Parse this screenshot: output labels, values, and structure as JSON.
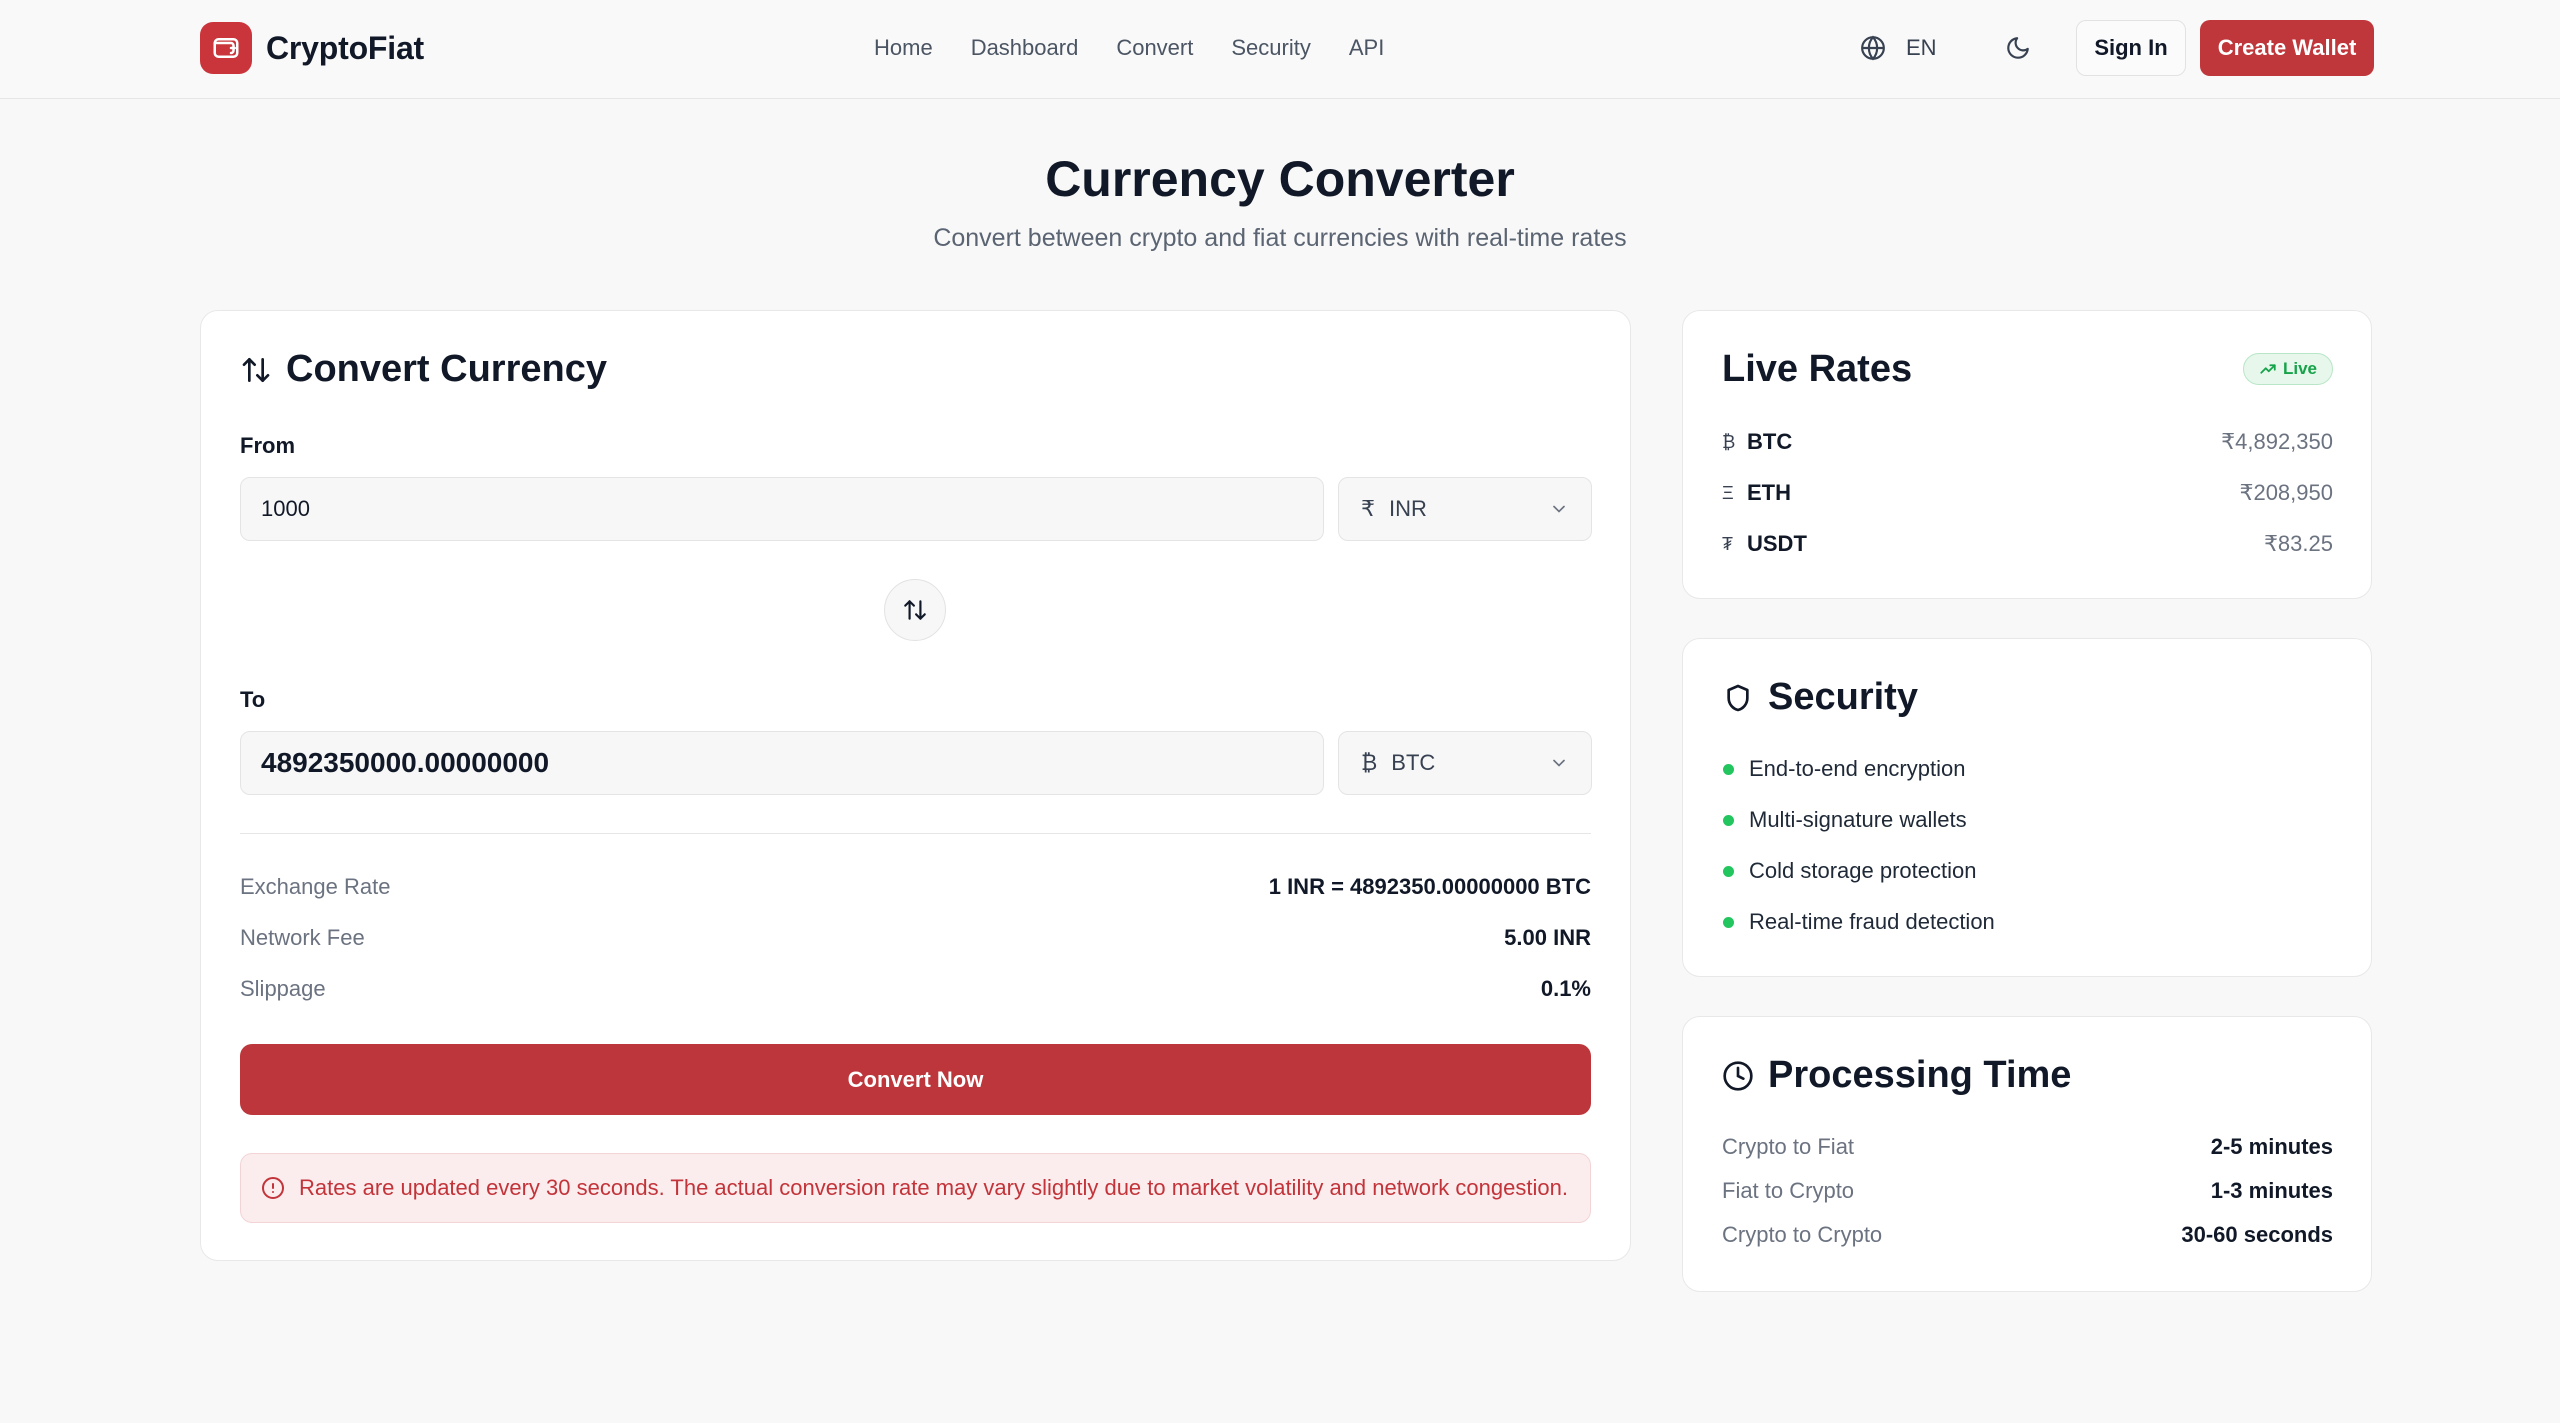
{
  "header": {
    "brand": "CryptoFiat",
    "nav": [
      "Home",
      "Dashboard",
      "Convert",
      "Security",
      "API"
    ],
    "language": "EN",
    "sign_in": "Sign In",
    "create_wallet": "Create Wallet"
  },
  "hero": {
    "title": "Currency Converter",
    "subtitle": "Convert between crypto and fiat currencies with real-time rates"
  },
  "converter": {
    "title": "Convert Currency",
    "from_label": "From",
    "from_amount": "1000",
    "from_currency_symbol": "₹",
    "from_currency": "INR",
    "to_label": "To",
    "to_amount": "4892350000.00000000",
    "to_currency_symbol": "₿",
    "to_currency": "BTC",
    "details": [
      {
        "key": "Exchange Rate",
        "value": "1 INR = 4892350.00000000 BTC"
      },
      {
        "key": "Network Fee",
        "value": "5.00 INR"
      },
      {
        "key": "Slippage",
        "value": "0.1%"
      }
    ],
    "convert_button": "Convert Now",
    "notice": "Rates are updated every 30 seconds. The actual conversion rate may vary slightly due to market volatility and network congestion."
  },
  "live_rates": {
    "title": "Live Rates",
    "badge": "Live",
    "rates": [
      {
        "symbol": "₿",
        "name": "BTC",
        "value": "₹4,892,350"
      },
      {
        "symbol": "Ξ",
        "name": "ETH",
        "value": "₹208,950"
      },
      {
        "symbol": "₮",
        "name": "USDT",
        "value": "₹83.25"
      }
    ]
  },
  "security": {
    "title": "Security",
    "items": [
      "End-to-end encryption",
      "Multi-signature wallets",
      "Cold storage protection",
      "Real-time fraud detection"
    ]
  },
  "processing": {
    "title": "Processing Time",
    "rows": [
      {
        "key": "Crypto to Fiat",
        "value": "2-5 minutes"
      },
      {
        "key": "Fiat to Crypto",
        "value": "1-3 minutes"
      },
      {
        "key": "Crypto to Crypto",
        "value": "30-60 seconds"
      }
    ]
  },
  "colors": {
    "brand": "#bf363b",
    "live_green": "#22c55e",
    "background": "#f8f8f8"
  },
  "icons": [
    "wallet-icon",
    "globe-icon",
    "moon-icon",
    "swap-vertical-icon",
    "chevron-down-icon",
    "trending-up-icon",
    "shield-icon",
    "clock-icon",
    "alert-circle-icon"
  ]
}
